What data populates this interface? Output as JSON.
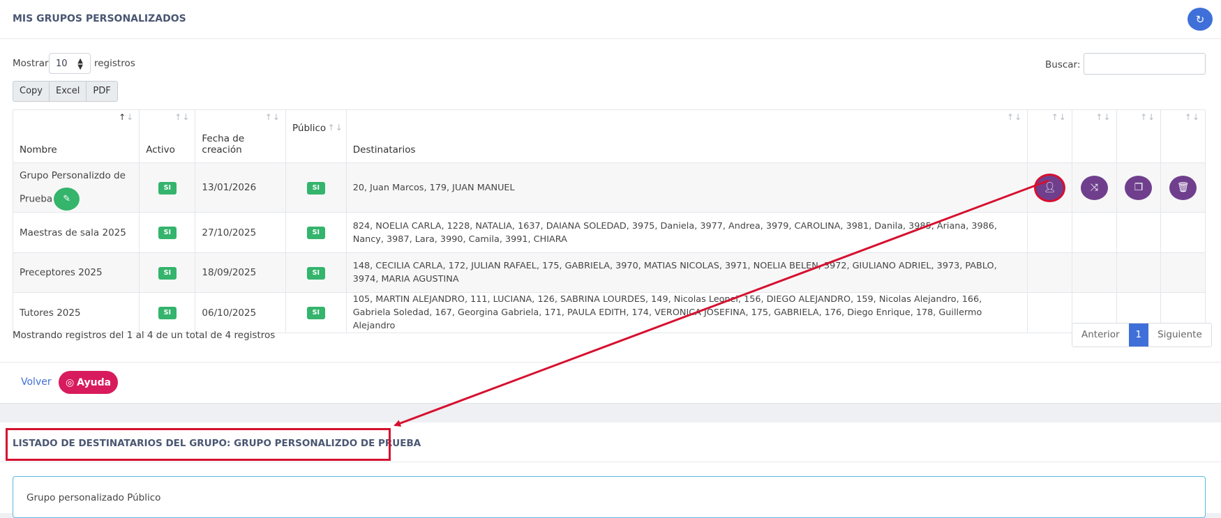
{
  "card1": {
    "title": "MIS GRUPOS PERSONALIZADOS",
    "refresh_icon": "refresh-icon"
  },
  "controls": {
    "show_label": "Mostrar",
    "page_size": "10",
    "records_label": "registros",
    "search_label": "Buscar:",
    "search_value": "",
    "export_buttons": [
      "Copy",
      "Excel",
      "PDF"
    ]
  },
  "table": {
    "headers": {
      "nombre": "Nombre",
      "activo": "Activo",
      "fecha_line1": "Fecha de",
      "fecha_line2": "creación",
      "publico": "Público",
      "destinatarios": "Destinatarios"
    },
    "rows": [
      {
        "nombre": "Grupo Personalizdo de Prueba",
        "activo": "SI",
        "fecha": "13/01/2026",
        "publico": "SI",
        "destinatarios": "20, Juan Marcos, 179, JUAN MANUEL"
      },
      {
        "nombre": "Maestras de sala 2025",
        "activo": "SI",
        "fecha": "27/10/2025",
        "publico": "SI",
        "destinatarios": "824, NOELIA CARLA, 1228, NATALIA, 1637, DAIANA SOLEDAD, 3975, Daniela, 3977, Andrea, 3979, CAROLINA, 3981, Danila, 3985, Ariana, 3986, Nancy, 3987, Lara, 3990, Camila, 3991, CHIARA"
      },
      {
        "nombre": "Preceptores 2025",
        "activo": "SI",
        "fecha": "18/09/2025",
        "publico": "SI",
        "destinatarios": "148, CECILIA CARLA, 172, JULIAN RAFAEL, 175, GABRIELA, 3970, MATIAS NICOLAS, 3971, NOELIA BELEN, 3972, GIULIANO ADRIEL, 3973, PABLO, 3974, MARIA AGUSTINA"
      },
      {
        "nombre": "Tutores 2025",
        "activo": "SI",
        "fecha": "06/10/2025",
        "publico": "SI",
        "destinatarios": "105, MARTIN ALEJANDRO, 111, LUCIANA, 126, SABRINA LOURDES, 149, Nicolas Leonel, 156, DIEGO ALEJANDRO, 159, Nicolas Alejandro, 166, Gabriela Soledad, 167, Georgina Gabriela, 171, PAULA EDITH, 174, VERONICA JOSEFINA, 175, GABRIELA, 176, Diego Enrique, 178, Guillermo Alejandro"
      }
    ],
    "row_action_icons": [
      "add-user-icon",
      "shuffle-icon",
      "copy-icon",
      "trash-icon"
    ]
  },
  "footer_info": {
    "summary": "Mostrando registros del 1 al 4 de un total de 4 registros",
    "prev": "Anterior",
    "current_page": "1",
    "next": "Siguiente"
  },
  "card_footer": {
    "back": "Volver",
    "help": "Ayuda"
  },
  "card2": {
    "title": "LISTADO DE DESTINATARIOS DEL GRUPO: GRUPO PERSONALIZDO DE PRUEBA",
    "box_text": "Grupo personalizado Público"
  },
  "colors": {
    "primary": "#3f6fd8",
    "success": "#34b46c",
    "action_purple": "#6f3f8d",
    "help_pink": "#d81b5c",
    "annotation_red": "#d6102f"
  }
}
